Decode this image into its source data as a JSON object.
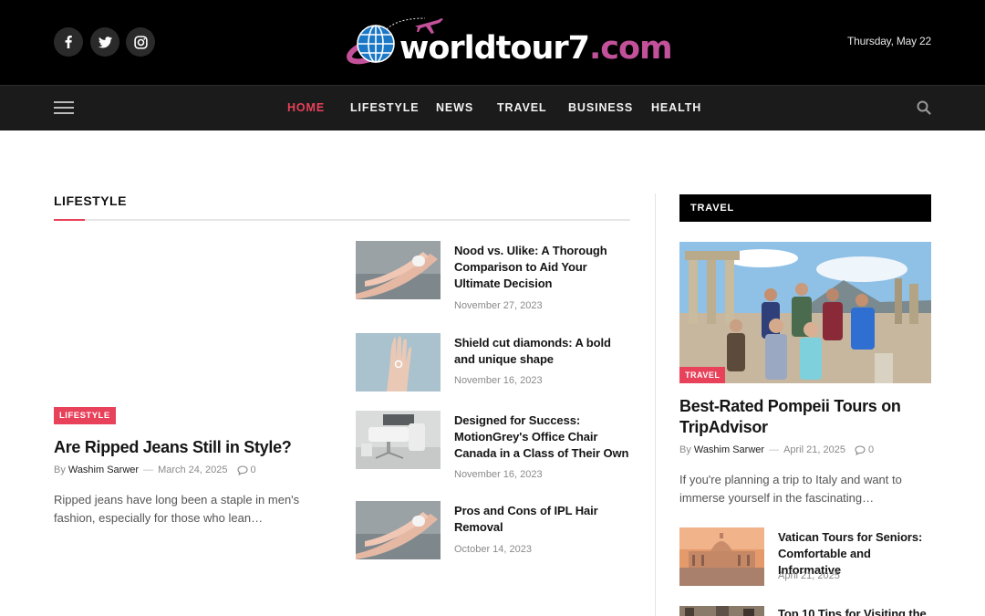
{
  "header": {
    "date": "Thursday, May 22",
    "logo": {
      "main_text": "worldtour7",
      "tld_text": ".com"
    },
    "social": [
      "facebook-icon",
      "twitter-icon",
      "instagram-icon"
    ]
  },
  "nav": {
    "items": [
      {
        "label": "HOME",
        "active": true
      },
      {
        "label": "LIFESTYLE",
        "active": false
      },
      {
        "label": "NEWS",
        "active": false
      },
      {
        "label": "TRAVEL",
        "active": false
      },
      {
        "label": "BUSINESS",
        "active": false
      },
      {
        "label": "HEALTH",
        "active": false
      }
    ]
  },
  "colors": {
    "accent": "#e8415a",
    "header_bg": "#000000",
    "nav_bg": "#1b1b1b",
    "logo_tld": "#c2519a"
  },
  "lifestyle": {
    "heading": "LIFESTYLE",
    "featured": {
      "category": "LIFESTYLE",
      "title": "Are Ripped Jeans Still in Style?",
      "by": "By",
      "author": "Washim Sarwer",
      "date": "March 24, 2025",
      "comments": "0",
      "excerpt": "Ripped jeans have long been a staple in men's fashion, especially for those who lean…"
    },
    "posts": [
      {
        "title": "Nood vs. Ulike: A Thorough Comparison to Aid Your Ultimate Decision",
        "date": "November 27, 2023"
      },
      {
        "title": "Shield cut diamonds: A bold and unique shape",
        "date": "November 16, 2023"
      },
      {
        "title": "Designed for Success: MotionGrey's Office Chair Canada in a Class of Their Own",
        "date": "November 16, 2023"
      },
      {
        "title": "Pros and Cons of IPL Hair Removal",
        "date": "October 14, 2023"
      }
    ]
  },
  "sidebar": {
    "heading": "TRAVEL",
    "featured": {
      "category": "TRAVEL",
      "title": "Best-Rated Pompeii Tours on TripAdvisor",
      "by": "By",
      "author": "Washim Sarwer",
      "date": "April 21, 2025",
      "comments": "0",
      "excerpt": "If you're planning a trip to Italy and want to immerse yourself in the fascinating…"
    },
    "posts": [
      {
        "title": "Vatican Tours for Seniors: Comfortable and Informative",
        "date": "April 21, 2025"
      },
      {
        "title": "Top 10 Tips for Visiting the",
        "date": ""
      }
    ]
  }
}
